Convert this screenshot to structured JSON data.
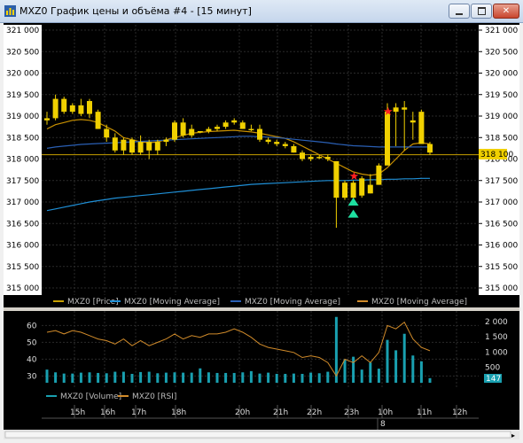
{
  "window": {
    "title": "MXZ0 График цены и объёма #4 - [15 минут]",
    "buttons": [
      "minimize",
      "restore",
      "close"
    ]
  },
  "price_axis": {
    "ticks": [
      "321 000",
      "320 500",
      "320 000",
      "319 500",
      "319 000",
      "318 500",
      "318 000",
      "317 500",
      "317 000",
      "316 500",
      "316 000",
      "315 500",
      "315 000"
    ],
    "current_price_label": "318 100"
  },
  "legend_price": [
    {
      "label": "MXZ0 [Price]",
      "color": "#c8a000"
    },
    {
      "label": "MXZ0 [Moving Average]",
      "color": "#1f8fd6"
    },
    {
      "label": "MXZ0 [Moving Average]",
      "color": "#2a5fb4"
    },
    {
      "label": "MXZ0 [Moving Average]",
      "color": "#d18b2a"
    }
  ],
  "indicator_axis_left": {
    "ticks": [
      "60",
      "50",
      "40",
      "30"
    ]
  },
  "indicator_axis_right": {
    "ticks": [
      "2 000",
      "1 500",
      "1 000",
      "500"
    ],
    "current_label": "147"
  },
  "legend_indicator": [
    {
      "label": "MXZ0 [Volume]",
      "color": "#19a0b0"
    },
    {
      "label": "MXZ0 [RSI]",
      "color": "#d18b2a"
    }
  ],
  "time_axis": {
    "labels": [
      "15h",
      "16h",
      "17h",
      "18h",
      "20h",
      "21h",
      "22h",
      "23h",
      "10h",
      "11h",
      "12h"
    ],
    "date_label": "8"
  },
  "colors": {
    "candle": "#f0d000",
    "ma_fast": "#c89000",
    "ma_mid": "#2a5fb4",
    "ma_slow": "#1f8fd6",
    "background": "#000000",
    "grid": "#2a2a2a",
    "signal_buy": "#1ee0a0",
    "signal_star": "#ff2020"
  },
  "chart_data": {
    "type": "candlestick",
    "ylim": [
      315000,
      321000
    ],
    "candles": [
      [
        318900,
        319100,
        318800,
        318950
      ],
      [
        318950,
        319500,
        318900,
        319400
      ],
      [
        319400,
        319450,
        319050,
        319100
      ],
      [
        319100,
        319300,
        319050,
        319250
      ],
      [
        319250,
        319400,
        319000,
        319050
      ],
      [
        319050,
        319400,
        318950,
        319350
      ],
      [
        319100,
        319150,
        318700,
        318700
      ],
      [
        318700,
        318800,
        318400,
        318500
      ],
      [
        318500,
        318600,
        318150,
        318200
      ],
      [
        318200,
        318500,
        318100,
        318450
      ],
      [
        318450,
        318500,
        318100,
        318150
      ],
      [
        318150,
        318550,
        318100,
        318400
      ],
      [
        318400,
        318450,
        318000,
        318200
      ],
      [
        318200,
        318450,
        318100,
        318400
      ],
      [
        318400,
        318500,
        318300,
        318450
      ],
      [
        318450,
        318900,
        318400,
        318850
      ],
      [
        318850,
        318950,
        318500,
        318550
      ],
      [
        318550,
        318800,
        318500,
        318700
      ],
      [
        318650,
        318650,
        318600,
        318650
      ],
      [
        318650,
        318750,
        318600,
        318700
      ],
      [
        318700,
        318800,
        318650,
        318750
      ],
      [
        318750,
        318900,
        318700,
        318850
      ],
      [
        318850,
        318950,
        318800,
        318900
      ],
      [
        318850,
        318900,
        318700,
        318700
      ],
      [
        318700,
        318800,
        318650,
        318700
      ],
      [
        318700,
        318800,
        318400,
        318450
      ],
      [
        318450,
        318500,
        318350,
        318400
      ],
      [
        318400,
        318450,
        318300,
        318350
      ],
      [
        318350,
        318400,
        318250,
        318300
      ],
      [
        318300,
        318350,
        318150,
        318150
      ],
      [
        318150,
        318200,
        317950,
        318000
      ],
      [
        318000,
        318100,
        317950,
        318050
      ],
      [
        318050,
        318100,
        318000,
        318050
      ],
      [
        318050,
        318100,
        317950,
        318000
      ],
      [
        317950,
        317950,
        316400,
        317100
      ],
      [
        317100,
        317500,
        317050,
        317450
      ],
      [
        317450,
        317500,
        316950,
        317100
      ],
      [
        317150,
        317600,
        317100,
        317550
      ],
      [
        317200,
        317650,
        317200,
        317400
      ],
      [
        317400,
        317900,
        317400,
        317850
      ],
      [
        317850,
        319300,
        317900,
        319100
      ],
      [
        319100,
        319300,
        318300,
        319200
      ],
      [
        319200,
        319350,
        318200,
        319150
      ],
      [
        318850,
        319100,
        318450,
        318900
      ],
      [
        319100,
        319150,
        318350,
        318350
      ],
      [
        318350,
        318400,
        318100,
        318150
      ]
    ],
    "moving_averages": [
      {
        "name": "MXZ0 [Moving Average]",
        "color": "#c89000",
        "values": [
          318700,
          318800,
          318850,
          318900,
          318920,
          318900,
          318850,
          318750,
          318650,
          318500,
          318450,
          318400,
          318380,
          318400,
          318450,
          318500,
          318550,
          318600,
          318620,
          318640,
          318650,
          318660,
          318670,
          318650,
          318630,
          318600,
          318560,
          318520,
          318480,
          318400,
          318300,
          318200,
          318100,
          318000,
          317900,
          317800,
          317700,
          317650,
          317620,
          317650,
          317800,
          318000,
          318200,
          318350,
          318380,
          318350
        ]
      },
      {
        "name": "MXZ0 [Moving Average]",
        "color": "#2a5fb4",
        "values": [
          318250,
          318280,
          318300,
          318320,
          318340,
          318350,
          318360,
          318370,
          318380,
          318390,
          318400,
          318410,
          318420,
          318430,
          318440,
          318450,
          318460,
          318470,
          318480,
          318490,
          318500,
          318510,
          318520,
          318530,
          318530,
          318520,
          318510,
          318500,
          318480,
          318460,
          318440,
          318420,
          318400,
          318380,
          318350,
          318330,
          318310,
          318300,
          318290,
          318280,
          318280,
          318280,
          318280,
          318280,
          318280,
          318280
        ]
      },
      {
        "name": "MXZ0 [Moving Average]",
        "color": "#1f8fd6",
        "values": [
          316800,
          316840,
          316880,
          316920,
          316960,
          317000,
          317030,
          317060,
          317090,
          317110,
          317130,
          317150,
          317170,
          317190,
          317210,
          317230,
          317250,
          317270,
          317290,
          317310,
          317330,
          317350,
          317370,
          317390,
          317410,
          317420,
          317430,
          317440,
          317450,
          317460,
          317470,
          317480,
          317490,
          317500,
          317500,
          317500,
          317510,
          317510,
          317520,
          317520,
          317530,
          317530,
          317540,
          317540,
          317550,
          317550
        ]
      }
    ],
    "signals": [
      {
        "type": "star",
        "candle_index": 36,
        "price": 317600
      },
      {
        "type": "buy_arrow",
        "candle_index": 36,
        "price": 317000
      },
      {
        "type": "buy_arrow",
        "candle_index": 36,
        "price": 316720
      },
      {
        "type": "star",
        "candle_index": 40,
        "price": 319100
      }
    ],
    "volume": [
      430,
      340,
      300,
      300,
      330,
      340,
      320,
      310,
      360,
      360,
      290,
      350,
      360,
      310,
      330,
      340,
      330,
      330,
      470,
      340,
      320,
      320,
      320,
      340,
      380,
      300,
      330,
      290,
      290,
      300,
      290,
      330,
      310,
      360,
      2150,
      760,
      850,
      430,
      660,
      460,
      1400,
      1060,
      1600,
      890,
      700,
      150
    ],
    "rsi": [
      56,
      57,
      55,
      57,
      56,
      54,
      52,
      51,
      49,
      52,
      48,
      51,
      48,
      50,
      52,
      55,
      52,
      54,
      53,
      55,
      55,
      56,
      58,
      56,
      53,
      49,
      47,
      46,
      45,
      44,
      41,
      42,
      41,
      38,
      30,
      40,
      38,
      42,
      38,
      44,
      60,
      58,
      62,
      52,
      47,
      45
    ],
    "volume_ylim": [
      0,
      2200
    ],
    "rsi_ylim": [
      26,
      66
    ]
  }
}
